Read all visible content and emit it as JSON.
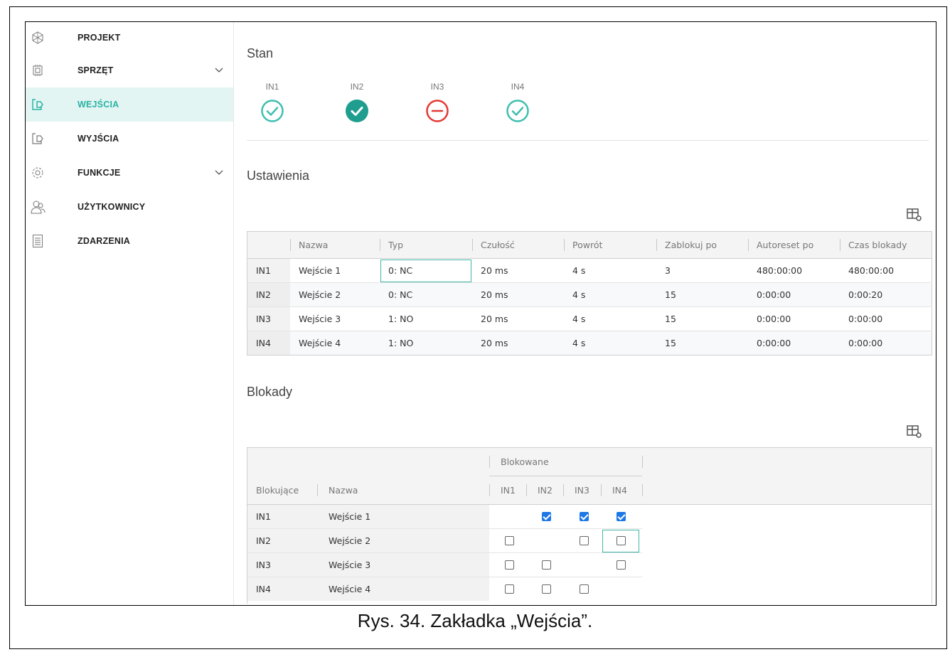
{
  "sidebar": {
    "items": [
      {
        "label": "PROJEKT",
        "icon": "project-icon"
      },
      {
        "label": "SPRZĘT",
        "icon": "hardware-icon"
      },
      {
        "label": "WEJŚCIA",
        "icon": "input-icon"
      },
      {
        "label": "WYJŚCIA",
        "icon": "output-icon"
      },
      {
        "label": "FUNKCJE",
        "icon": "gear-icon"
      },
      {
        "label": "UŻYTKOWNICY",
        "icon": "users-icon"
      },
      {
        "label": "ZDARZENIA",
        "icon": "events-icon"
      }
    ],
    "active": "WEJŚCIA",
    "accent_color": "#2bb3a3"
  },
  "state": {
    "title": "Stan",
    "inputs": [
      {
        "label": "IN1",
        "status": "ok-outline"
      },
      {
        "label": "IN2",
        "status": "ok-filled"
      },
      {
        "label": "IN3",
        "status": "blocked"
      },
      {
        "label": "IN4",
        "status": "ok-outline"
      }
    ],
    "colors": {
      "ok": "#3fbfae",
      "ok_filled": "#1f9e8f",
      "blocked": "#e53935"
    }
  },
  "settings": {
    "title": "Ustawienia",
    "table_settings_icon": "table-settings-icon",
    "headers": [
      "",
      "Nazwa",
      "Typ",
      "Czułość",
      "Powrót",
      "Zablokuj po",
      "Autoreset po",
      "Czas blokady"
    ],
    "rows": [
      [
        "IN1",
        "Wejście 1",
        "0: NC",
        "20 ms",
        "4 s",
        "3",
        "480:00:00",
        "480:00:00"
      ],
      [
        "IN2",
        "Wejście 2",
        "0: NC",
        "20 ms",
        "4 s",
        "15",
        "0:00:00",
        "0:00:20"
      ],
      [
        "IN3",
        "Wejście 3",
        "1: NO",
        "20 ms",
        "4 s",
        "15",
        "0:00:00",
        "0:00:00"
      ],
      [
        "IN4",
        "Wejście 4",
        "1: NO",
        "20 ms",
        "4 s",
        "15",
        "0:00:00",
        "0:00:00"
      ]
    ]
  },
  "blocks": {
    "title": "Blokady",
    "group_header": "Blokowane",
    "col_blocking": "Blokujące",
    "col_name": "Nazwa",
    "cols": [
      "IN1",
      "IN2",
      "IN3",
      "IN4"
    ],
    "rows": [
      {
        "id": "IN1",
        "name": "Wejście 1",
        "checks": [
          null,
          true,
          true,
          true
        ]
      },
      {
        "id": "IN2",
        "name": "Wejście 2",
        "checks": [
          false,
          null,
          false,
          false
        ]
      },
      {
        "id": "IN3",
        "name": "Wejście 3",
        "checks": [
          false,
          false,
          null,
          false
        ]
      },
      {
        "id": "IN4",
        "name": "Wejście 4",
        "checks": [
          false,
          false,
          false,
          null
        ]
      }
    ]
  },
  "caption": "Rys. 34. Zakładka „Wejścia”."
}
